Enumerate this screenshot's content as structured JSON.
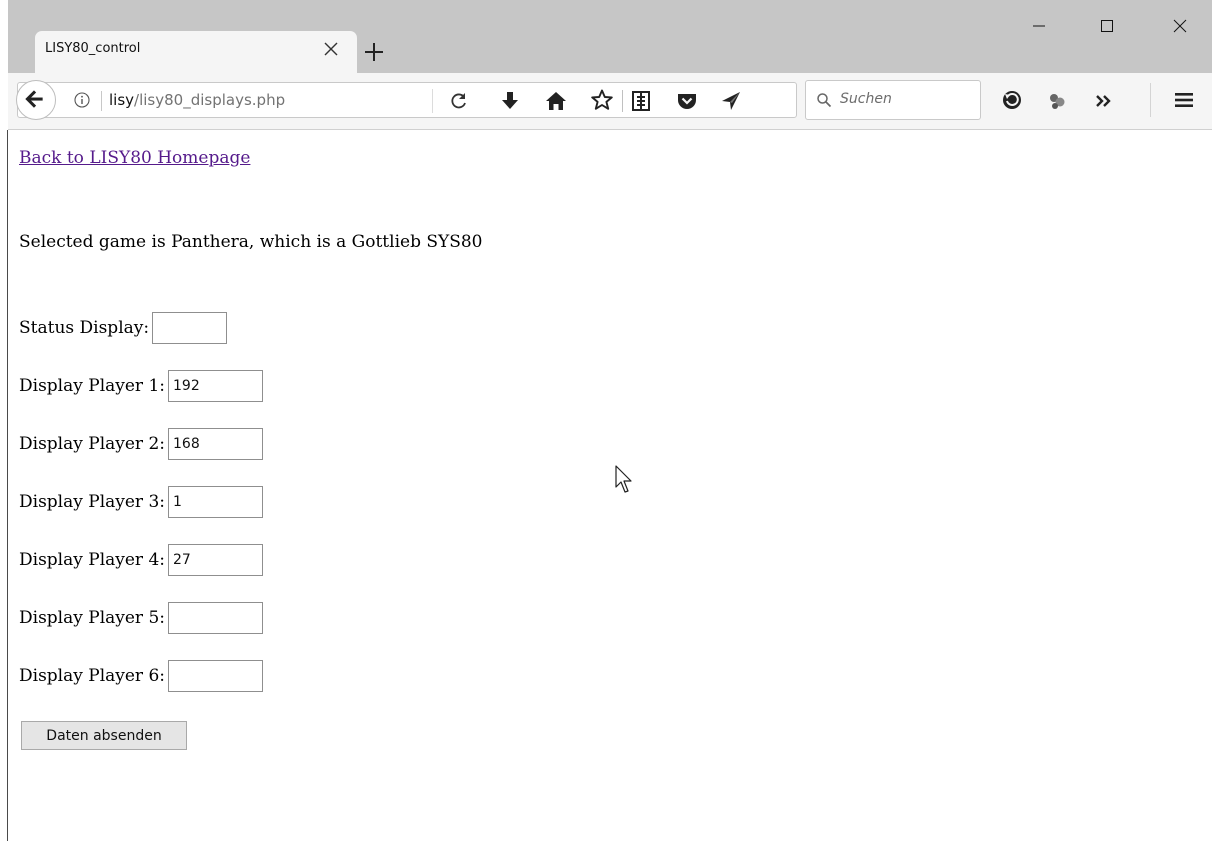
{
  "browser": {
    "tab_title": "LISY80_control",
    "url_host": "lisy",
    "url_path": "/lisy80_displays.php",
    "search_placeholder": "Suchen"
  },
  "page": {
    "back_link": "Back to LISY80 Homepage",
    "game_info": "Selected game is Panthera, which is a Gottlieb SYS80",
    "fields": [
      {
        "label": "Status Display:",
        "value": ""
      },
      {
        "label": "Display Player 1:",
        "value": "192"
      },
      {
        "label": "Display Player 2:",
        "value": "168"
      },
      {
        "label": "Display Player 3:",
        "value": "1"
      },
      {
        "label": "Display Player 4:",
        "value": "27"
      },
      {
        "label": "Display Player 5:",
        "value": ""
      },
      {
        "label": "Display Player 6:",
        "value": ""
      }
    ],
    "submit_label": "Daten absenden"
  },
  "colors": {
    "titlebar": "#c6c6c6",
    "toolbar": "#f5f5f5",
    "visited_link": "#551a8b"
  }
}
